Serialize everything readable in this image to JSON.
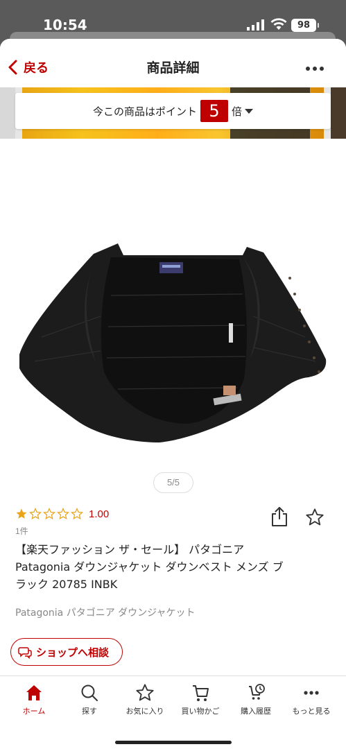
{
  "status_bar": {
    "time": "10:54",
    "battery": "98"
  },
  "header": {
    "back_label": "戻る",
    "title": "商品詳細"
  },
  "points_banner": {
    "prefix": "今この商品はポイント",
    "multiplier": "5",
    "suffix": "倍"
  },
  "gallery": {
    "pager": "5/5"
  },
  "product": {
    "rating_value": "1.00",
    "rating_stars": 1,
    "review_count": "1件",
    "title_line1": "【楽天ファッション ザ・セール】 パタゴニア",
    "title_line2": "Patagonia ダウンジャケット ダウンベスト メンズ ブ",
    "title_line3": "ラック 20785 INBK",
    "tags": "Patagonia パタゴニア ダウンジャケット"
  },
  "consult_label": "ショップへ相談",
  "bottom_nav": {
    "home": "ホーム",
    "search": "探す",
    "favorites": "お気に入り",
    "cart": "買い物かご",
    "history": "購入履歴",
    "more": "もっと見る"
  },
  "colors": {
    "accent": "#bf0000",
    "star": "#e8a317"
  }
}
